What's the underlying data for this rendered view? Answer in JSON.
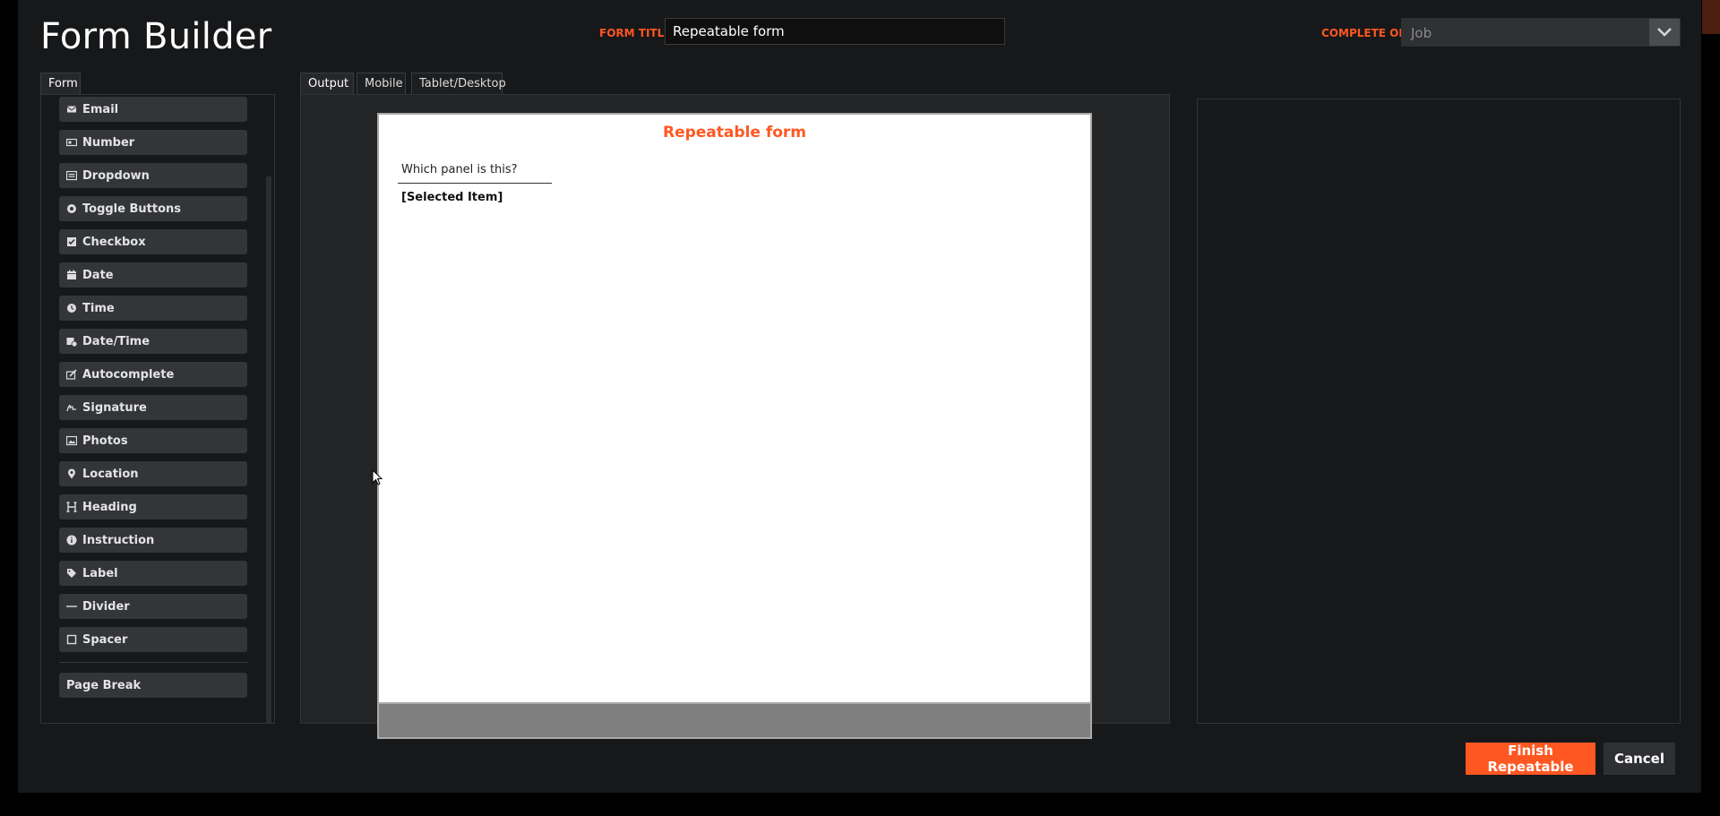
{
  "header": {
    "app_title": "Form Builder",
    "form_title_label": "FORM TITLE",
    "form_title_value": "Repeatable form",
    "complete_on_label": "COMPLETE ON",
    "complete_on_value": "Job"
  },
  "left_panel": {
    "tab": "Form",
    "tools": [
      {
        "label": "Email",
        "icon": "envelope-icon"
      },
      {
        "label": "Number",
        "icon": "number-icon"
      },
      {
        "label": "Dropdown",
        "icon": "dropdown-icon"
      },
      {
        "label": "Toggle Buttons",
        "icon": "toggle-icon"
      },
      {
        "label": "Checkbox",
        "icon": "checkbox-icon"
      },
      {
        "label": "Date",
        "icon": "calendar-icon"
      },
      {
        "label": "Time",
        "icon": "clock-icon"
      },
      {
        "label": "Date/Time",
        "icon": "calendar-clock-icon"
      },
      {
        "label": "Autocomplete",
        "icon": "autocomplete-icon"
      },
      {
        "label": "Signature",
        "icon": "signature-icon"
      },
      {
        "label": "Photos",
        "icon": "image-icon"
      },
      {
        "label": "Location",
        "icon": "map-pin-icon"
      },
      {
        "label": "Heading",
        "icon": "heading-icon"
      },
      {
        "label": "Instruction",
        "icon": "info-icon"
      },
      {
        "label": "Label",
        "icon": "tag-icon"
      },
      {
        "label": "Divider",
        "icon": "divider-icon"
      },
      {
        "label": "Spacer",
        "icon": "spacer-icon"
      }
    ],
    "page_break": "Page Break"
  },
  "center_panel": {
    "tabs": [
      "Output",
      "Mobile",
      "Tablet/Desktop"
    ],
    "active_tab": "Output",
    "preview": {
      "title": "Repeatable form",
      "question": "Which panel is this?",
      "value": "[Selected Item]"
    }
  },
  "footer": {
    "finish_label": "Finish Repeatable",
    "cancel_label": "Cancel"
  },
  "colors": {
    "accent": "#ff5722",
    "background": "#17181a",
    "button": "#333538"
  }
}
